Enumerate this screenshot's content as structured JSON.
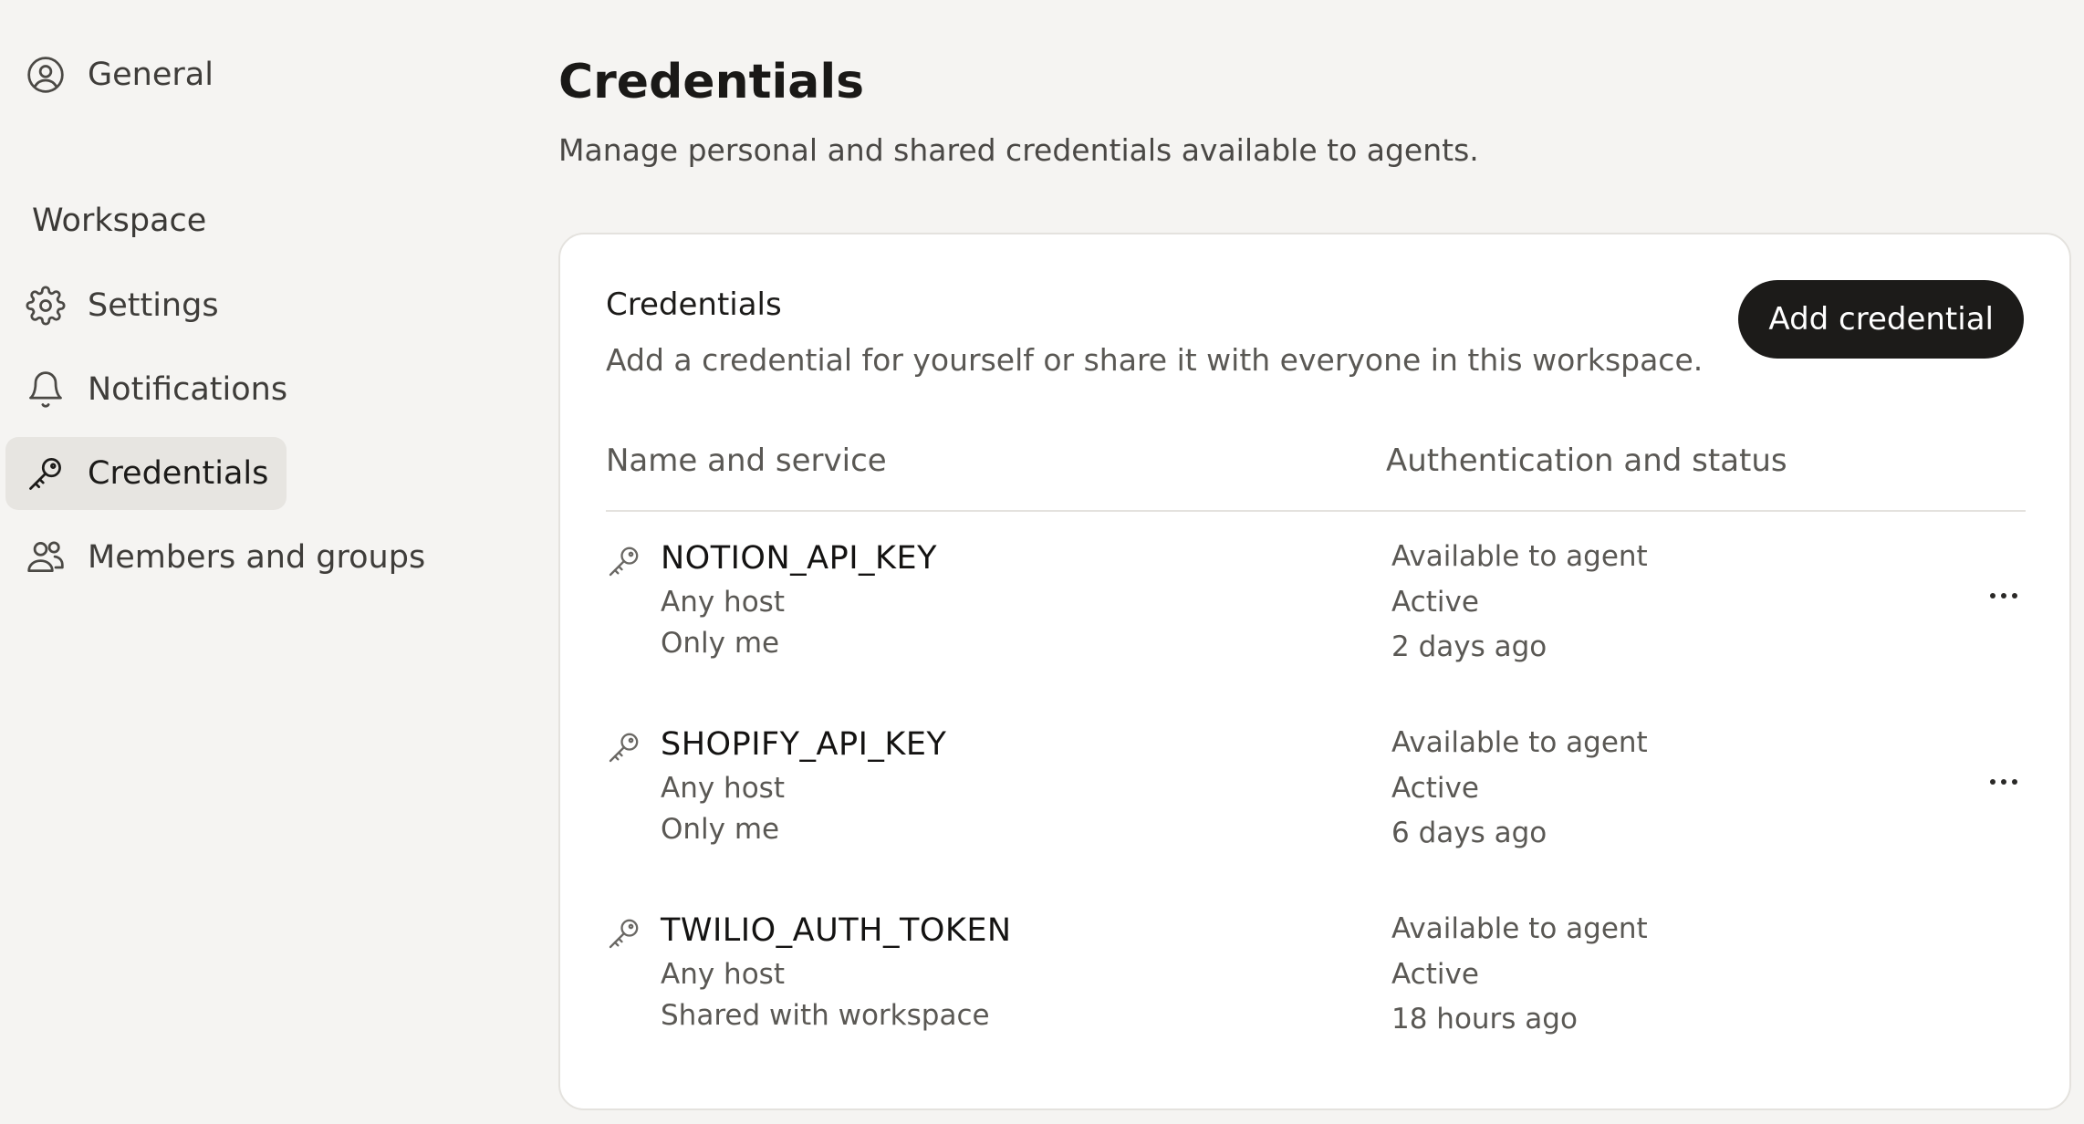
{
  "sidebar": {
    "top_item": {
      "label": "General",
      "icon": "user-circle-icon"
    },
    "section_label": "Workspace",
    "items": [
      {
        "label": "Settings",
        "icon": "gear-icon",
        "active": false
      },
      {
        "label": "Notifications",
        "icon": "bell-icon",
        "active": false
      },
      {
        "label": "Credentials",
        "icon": "key-icon",
        "active": true
      },
      {
        "label": "Members and groups",
        "icon": "users-icon",
        "active": false
      }
    ]
  },
  "page": {
    "title": "Credentials",
    "subtitle": "Manage personal and shared credentials available to agents."
  },
  "card": {
    "title": "Credentials",
    "description": "Add a credential for yourself or share it with everyone in this workspace.",
    "add_button_label": "Add credential",
    "columns": [
      "Name and service",
      "Authentication and status"
    ],
    "rows": [
      {
        "name": "NOTION_API_KEY",
        "host": "Any host",
        "scope": "Only me",
        "availability": "Available to agent",
        "status": "Active",
        "updated": "2 days ago",
        "has_menu": true
      },
      {
        "name": "SHOPIFY_API_KEY",
        "host": "Any host",
        "scope": "Only me",
        "availability": "Available to agent",
        "status": "Active",
        "updated": "6 days ago",
        "has_menu": true
      },
      {
        "name": "TWILIO_AUTH_TOKEN",
        "host": "Any host",
        "scope": "Shared with workspace",
        "availability": "Available to agent",
        "status": "Active",
        "updated": "18 hours ago",
        "has_menu": false
      }
    ]
  },
  "colors": {
    "background": "#f5f4f2",
    "card": "#ffffff",
    "primary_button": "#1c1b19",
    "active_nav": "#e7e5e1"
  }
}
